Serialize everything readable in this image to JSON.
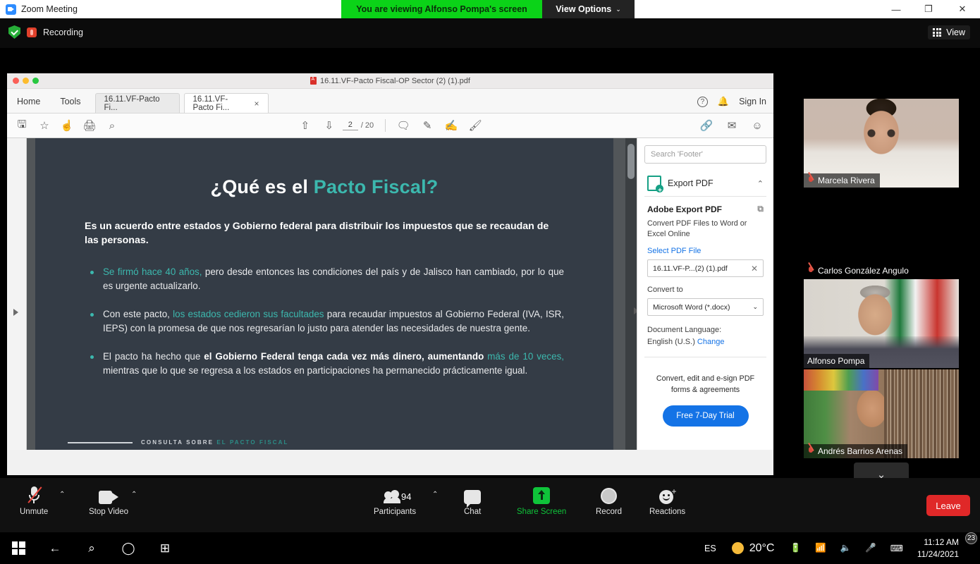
{
  "zoom_window": {
    "title": "Zoom Meeting",
    "share_banner": "You are viewing Alfonso Pompa's screen",
    "view_options": "View Options",
    "view_options_caret": "⌄",
    "minimize": "—",
    "maximize": "❐",
    "close": "✕",
    "recording_label": "Recording",
    "view_button": "View"
  },
  "pdf_window": {
    "title": "16.11.VF-Pacto Fiscal-OP Sector (2) (1).pdf",
    "menu": [
      "Home",
      "Tools"
    ],
    "tabs": [
      {
        "label": "16.11.VF-Pacto Fi...",
        "active": false
      },
      {
        "label": "16.11.VF-Pacto Fi...",
        "active": true,
        "close": "×"
      }
    ],
    "right_menu": {
      "help": "?",
      "bell": "☑",
      "sign_in": "Sign In"
    },
    "toolbar": {
      "save_icon": "⎙",
      "star_icon": "☆",
      "upload_icon": "⤒",
      "print_icon": "⎙",
      "zoom_icon": "⌕",
      "page_up_icon": "↑",
      "page_down_icon": "↓",
      "current_page": "2",
      "total_pages": "/ 20",
      "comment_icon": "❐",
      "highlight_icon": "✎",
      "draw_icon": "✐",
      "sign_icon": "✐",
      "share_icon": "↗",
      "mail_icon": "✉",
      "user_icon": "☺"
    }
  },
  "slide": {
    "title_plain": "¿Qué es el ",
    "title_accent": "Pacto Fiscal?",
    "lead": "Es un acuerdo entre estados y Gobierno federal para distribuir los impuestos que se recaudan de las personas.",
    "bullets": [
      {
        "accent_lead": "Se firmó hace 40 años,",
        "rest": " pero desde entonces las condiciones del país y de Jalisco han cambiado, por lo que es urgente actualizarlo."
      },
      {
        "pre": "Con este pacto, ",
        "accent_mid": "los estados cedieron sus facultades",
        "rest": " para recaudar impuestos al Gobierno Federal (IVA, ISR, IEPS) con la promesa de que nos regresarían lo justo para atender las necesidades de nuestra gente."
      },
      {
        "pre": "El pacto ha hecho que ",
        "bold_mid": "el Gobierno Federal tenga cada vez más dinero, aumentando ",
        "accent_mid2": "más de 10 veces,",
        "rest": " mientras que lo que se regresa a los estados en participaciones ha permanecido prácticamente igual."
      }
    ],
    "footer_plain": "CONSULTA SOBRE ",
    "footer_accent": "EL PACTO FISCAL"
  },
  "tools_panel": {
    "search_placeholder": "Search 'Footer'",
    "export_pdf_label": "Export PDF",
    "export_collapse_caret": "⌃",
    "section_title": "Adobe Export PDF",
    "copy_icon": "⧉",
    "description": "Convert PDF Files to Word or Excel Online",
    "select_pdf_link": "Select PDF File",
    "selected_file": "16.11.VF-P...(2) (1).pdf",
    "file_clear": "✕",
    "convert_to_label": "Convert to",
    "convert_to_value": "Microsoft Word (*.docx)",
    "convert_caret": "⌄",
    "document_language_label": "Document Language:",
    "document_language_value": "English (U.S.)",
    "change_link": "Change",
    "promo_text": "Convert, edit and e-sign PDF forms & agreements",
    "promo_button": "Free 7-Day Trial"
  },
  "participants": [
    {
      "name": "Marcela Rivera",
      "muted": true,
      "speaking": false,
      "video_off": false,
      "video_class": "vid-marcela"
    },
    {
      "name": "Carlos González Angulo",
      "muted": true,
      "speaking": false,
      "video_off": true,
      "video_class": "vid-black"
    },
    {
      "name": "Alfonso Pompa",
      "muted": false,
      "speaking": true,
      "video_off": false,
      "video_class": "vid-alfonso"
    },
    {
      "name": "Andrés Barrios Arenas",
      "muted": true,
      "speaking": false,
      "video_off": false,
      "video_class": "vid-andres"
    }
  ],
  "thumbs_more_caret": "⌄",
  "zoom_toolbar": {
    "unmute": "Unmute",
    "stop_video": "Stop Video",
    "participants": "Participants",
    "participants_count": "94",
    "chat": "Chat",
    "share_screen": "Share Screen",
    "record": "Record",
    "reactions": "Reactions",
    "leave": "Leave",
    "caret": "⌃",
    "reactions_plus": "+"
  },
  "taskbar": {
    "start_icon": "windows-logo",
    "back_icon": "←",
    "search_icon": "⌕",
    "cortana_icon": "◯",
    "taskview_icon": "⧉",
    "language": "ES",
    "temperature": "20°C",
    "battery_icon": "▤",
    "wifi_icon": "◠",
    "volume_icon": "ᵈ)",
    "mic_icon": "⌇",
    "keyboard_icon": "⌨",
    "time": "11:12 AM",
    "date": "11/24/2021",
    "notification_count": "23"
  }
}
